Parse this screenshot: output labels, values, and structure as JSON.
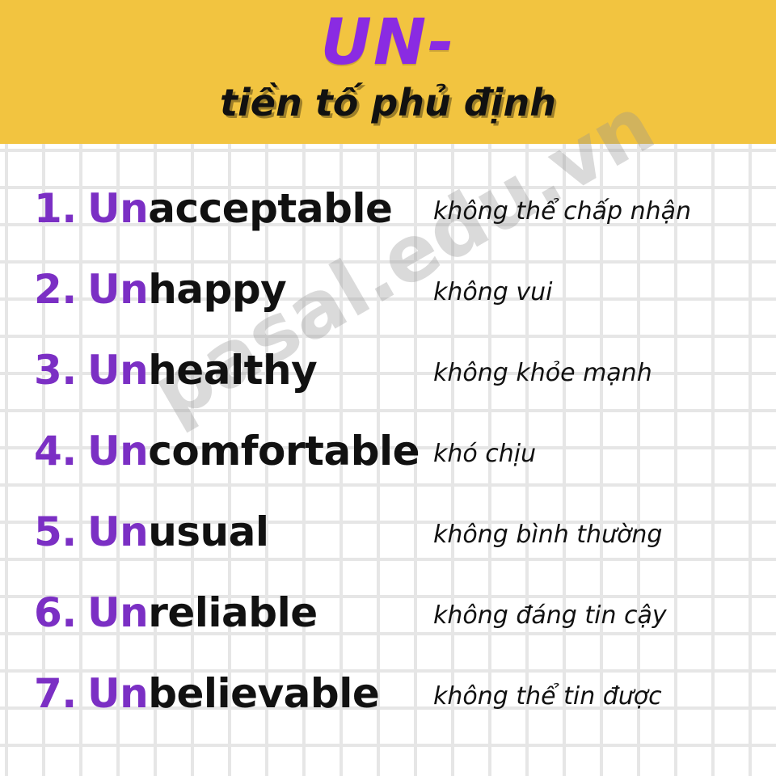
{
  "header": {
    "title": "UN-",
    "subtitle": "tiền tố phủ định"
  },
  "watermark": "pasal.edu.vn",
  "items": [
    {
      "number": "1.",
      "prefix": "Un",
      "rest": "acceptable",
      "meaning": "không thể chấp nhận"
    },
    {
      "number": "2.",
      "prefix": "Un",
      "rest": "happy",
      "meaning": "không vui"
    },
    {
      "number": "3.",
      "prefix": "Un",
      "rest": "healthy",
      "meaning": "không khỏe mạnh"
    },
    {
      "number": "4.",
      "prefix": "Un",
      "rest": "comfortable",
      "meaning": "khó chịu"
    },
    {
      "number": "5.",
      "prefix": "Un",
      "rest": "usual",
      "meaning": "không bình thường"
    },
    {
      "number": "6.",
      "prefix": "Un",
      "rest": "reliable",
      "meaning": "không đáng tin cậy"
    },
    {
      "number": "7.",
      "prefix": "Un",
      "rest": "believable",
      "meaning": "không thể tin được"
    }
  ],
  "colors": {
    "header_bg": "#f2c440",
    "accent_purple": "#7b2fc4",
    "text_dark": "#111111"
  }
}
